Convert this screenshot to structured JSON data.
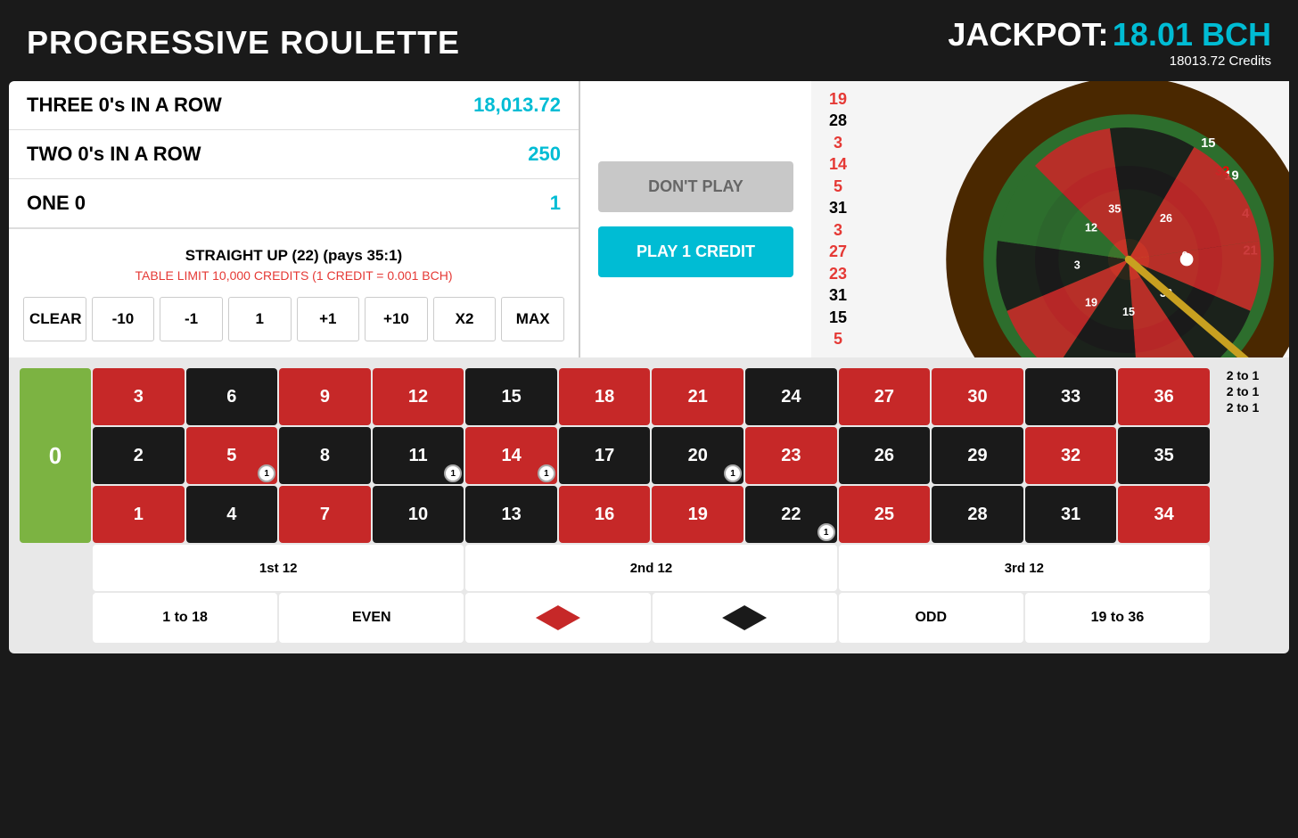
{
  "header": {
    "title": "PROGRESSIVE ROULETTE",
    "jackpot_label": "JACKPOT:",
    "jackpot_amount": "18.01 BCH",
    "jackpot_credits": "18013.72 Credits"
  },
  "payout_table": {
    "rows": [
      {
        "label": "THREE 0's IN A ROW",
        "value": "18,013.72"
      },
      {
        "label": "TWO 0's IN A ROW",
        "value": "250"
      },
      {
        "label": "ONE 0",
        "value": "1"
      }
    ]
  },
  "bet_info": {
    "title": "STRAIGHT UP (22) (pays 35:1)",
    "limit_text": "TABLE LIMIT 10,000 CREDITS (1 CREDIT = 0.001 BCH)"
  },
  "controls": {
    "buttons": [
      "CLEAR",
      "-10",
      "-1",
      "1",
      "+1",
      "+10",
      "X2",
      "MAX"
    ]
  },
  "action_buttons": {
    "dont_play": "DON'T PLAY",
    "play": "PLAY 1 CREDIT"
  },
  "wheel_numbers": [
    {
      "value": "19",
      "color": "red"
    },
    {
      "value": "28",
      "color": "black"
    },
    {
      "value": "3",
      "color": "red"
    },
    {
      "value": "14",
      "color": "red"
    },
    {
      "value": "5",
      "color": "red"
    },
    {
      "value": "31",
      "color": "black"
    },
    {
      "value": "3",
      "color": "red"
    },
    {
      "value": "27",
      "color": "red"
    },
    {
      "value": "23",
      "color": "red"
    },
    {
      "value": "31",
      "color": "black"
    },
    {
      "value": "15",
      "color": "black"
    },
    {
      "value": "5",
      "color": "red"
    }
  ],
  "board": {
    "zero": "0",
    "rows": [
      [
        {
          "n": "3",
          "c": "red"
        },
        {
          "n": "6",
          "c": "black"
        },
        {
          "n": "9",
          "c": "red"
        },
        {
          "n": "12",
          "c": "red"
        },
        {
          "n": "15",
          "c": "black"
        },
        {
          "n": "18",
          "c": "red"
        },
        {
          "n": "21",
          "c": "red"
        },
        {
          "n": "24",
          "c": "black"
        },
        {
          "n": "27",
          "c": "red"
        },
        {
          "n": "30",
          "c": "red"
        },
        {
          "n": "33",
          "c": "black"
        },
        {
          "n": "36",
          "c": "red"
        }
      ],
      [
        {
          "n": "2",
          "c": "black"
        },
        {
          "n": "5",
          "c": "red",
          "chip": "1"
        },
        {
          "n": "8",
          "c": "black"
        },
        {
          "n": "11",
          "c": "black",
          "chip": "1"
        },
        {
          "n": "14",
          "c": "red",
          "chip": "1"
        },
        {
          "n": "17",
          "c": "black"
        },
        {
          "n": "20",
          "c": "black",
          "chip": "1"
        },
        {
          "n": "23",
          "c": "red"
        },
        {
          "n": "26",
          "c": "black"
        },
        {
          "n": "29",
          "c": "black"
        },
        {
          "n": "32",
          "c": "red"
        },
        {
          "n": "35",
          "c": "black"
        }
      ],
      [
        {
          "n": "1",
          "c": "red"
        },
        {
          "n": "4",
          "c": "black"
        },
        {
          "n": "7",
          "c": "red"
        },
        {
          "n": "10",
          "c": "black"
        },
        {
          "n": "13",
          "c": "black"
        },
        {
          "n": "16",
          "c": "red"
        },
        {
          "n": "19",
          "c": "red"
        },
        {
          "n": "22",
          "c": "black",
          "chip": "1"
        },
        {
          "n": "25",
          "c": "red"
        },
        {
          "n": "28",
          "c": "black"
        },
        {
          "n": "31",
          "c": "black"
        },
        {
          "n": "34",
          "c": "red"
        }
      ]
    ],
    "two_to_one": [
      "2 to 1",
      "2 to 1",
      "2 to 1"
    ],
    "dozens": [
      "1st 12",
      "2nd 12",
      "3rd 12"
    ],
    "even_money": [
      "1 to 18",
      "EVEN",
      "RED",
      "BLACK",
      "ODD",
      "19 to 36"
    ]
  }
}
